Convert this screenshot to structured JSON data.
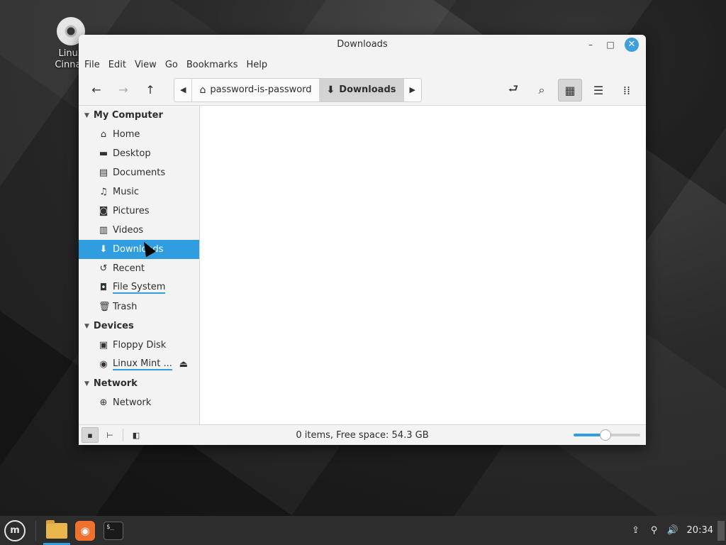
{
  "desktop": {
    "icon_label_line1": "Linux",
    "icon_label_line2": "Cinnan",
    "icon_name": "disc-icon"
  },
  "window": {
    "title": "Downloads",
    "controls": {
      "minimize": "–",
      "maximize": "□",
      "close": "✕"
    },
    "menu": [
      "File",
      "Edit",
      "View",
      "Go",
      "Bookmarks",
      "Help"
    ],
    "toolbar": {
      "back_icon": "←",
      "forward_icon": "→",
      "up_icon": "↑",
      "crumb_left_arrow": "◀",
      "crumb_right_arrow": "▶",
      "crumbs": [
        {
          "label": "password-is-password",
          "icon": "⌂"
        },
        {
          "label": "Downloads",
          "icon": "⬇"
        }
      ],
      "toggle_location_icon": "⮐",
      "search_icon": "⌕",
      "view_icons": "▦",
      "view_list": "☰",
      "view_compact": "⁞⁞"
    },
    "sidebar": {
      "sections": [
        {
          "title": "My Computer",
          "items": [
            {
              "label": "Home",
              "icon": "⌂"
            },
            {
              "label": "Desktop",
              "icon": "▬"
            },
            {
              "label": "Documents",
              "icon": "▤"
            },
            {
              "label": "Music",
              "icon": "♫"
            },
            {
              "label": "Pictures",
              "icon": "◙"
            },
            {
              "label": "Videos",
              "icon": "▥"
            },
            {
              "label": "Downloads",
              "icon": "⬇"
            },
            {
              "label": "Recent",
              "icon": "↺"
            },
            {
              "label": "File System",
              "icon": "◘"
            },
            {
              "label": "Trash",
              "icon": "🗑"
            }
          ]
        },
        {
          "title": "Devices",
          "items": [
            {
              "label": "Floppy Disk",
              "icon": "▣"
            },
            {
              "label": "Linux Mint ...",
              "icon": "◉",
              "eject": "⏏"
            }
          ]
        },
        {
          "title": "Network",
          "items": [
            {
              "label": "Network",
              "icon": "⊕"
            }
          ]
        }
      ],
      "expand_icon": "▼"
    },
    "statusbar": {
      "text": "0 items, Free space: 54.3 GB",
      "places_icon": "▪",
      "tree_icon": "⊢",
      "hide_sidebar_icon": "◧",
      "zoom_fraction": 0.48
    }
  },
  "taskbar": {
    "menu_label": "m",
    "clock": "20:34",
    "tray_icons": {
      "updates": "⇪",
      "network": "⚲",
      "volume": "🔊"
    },
    "terminal_prompt": "$_"
  }
}
